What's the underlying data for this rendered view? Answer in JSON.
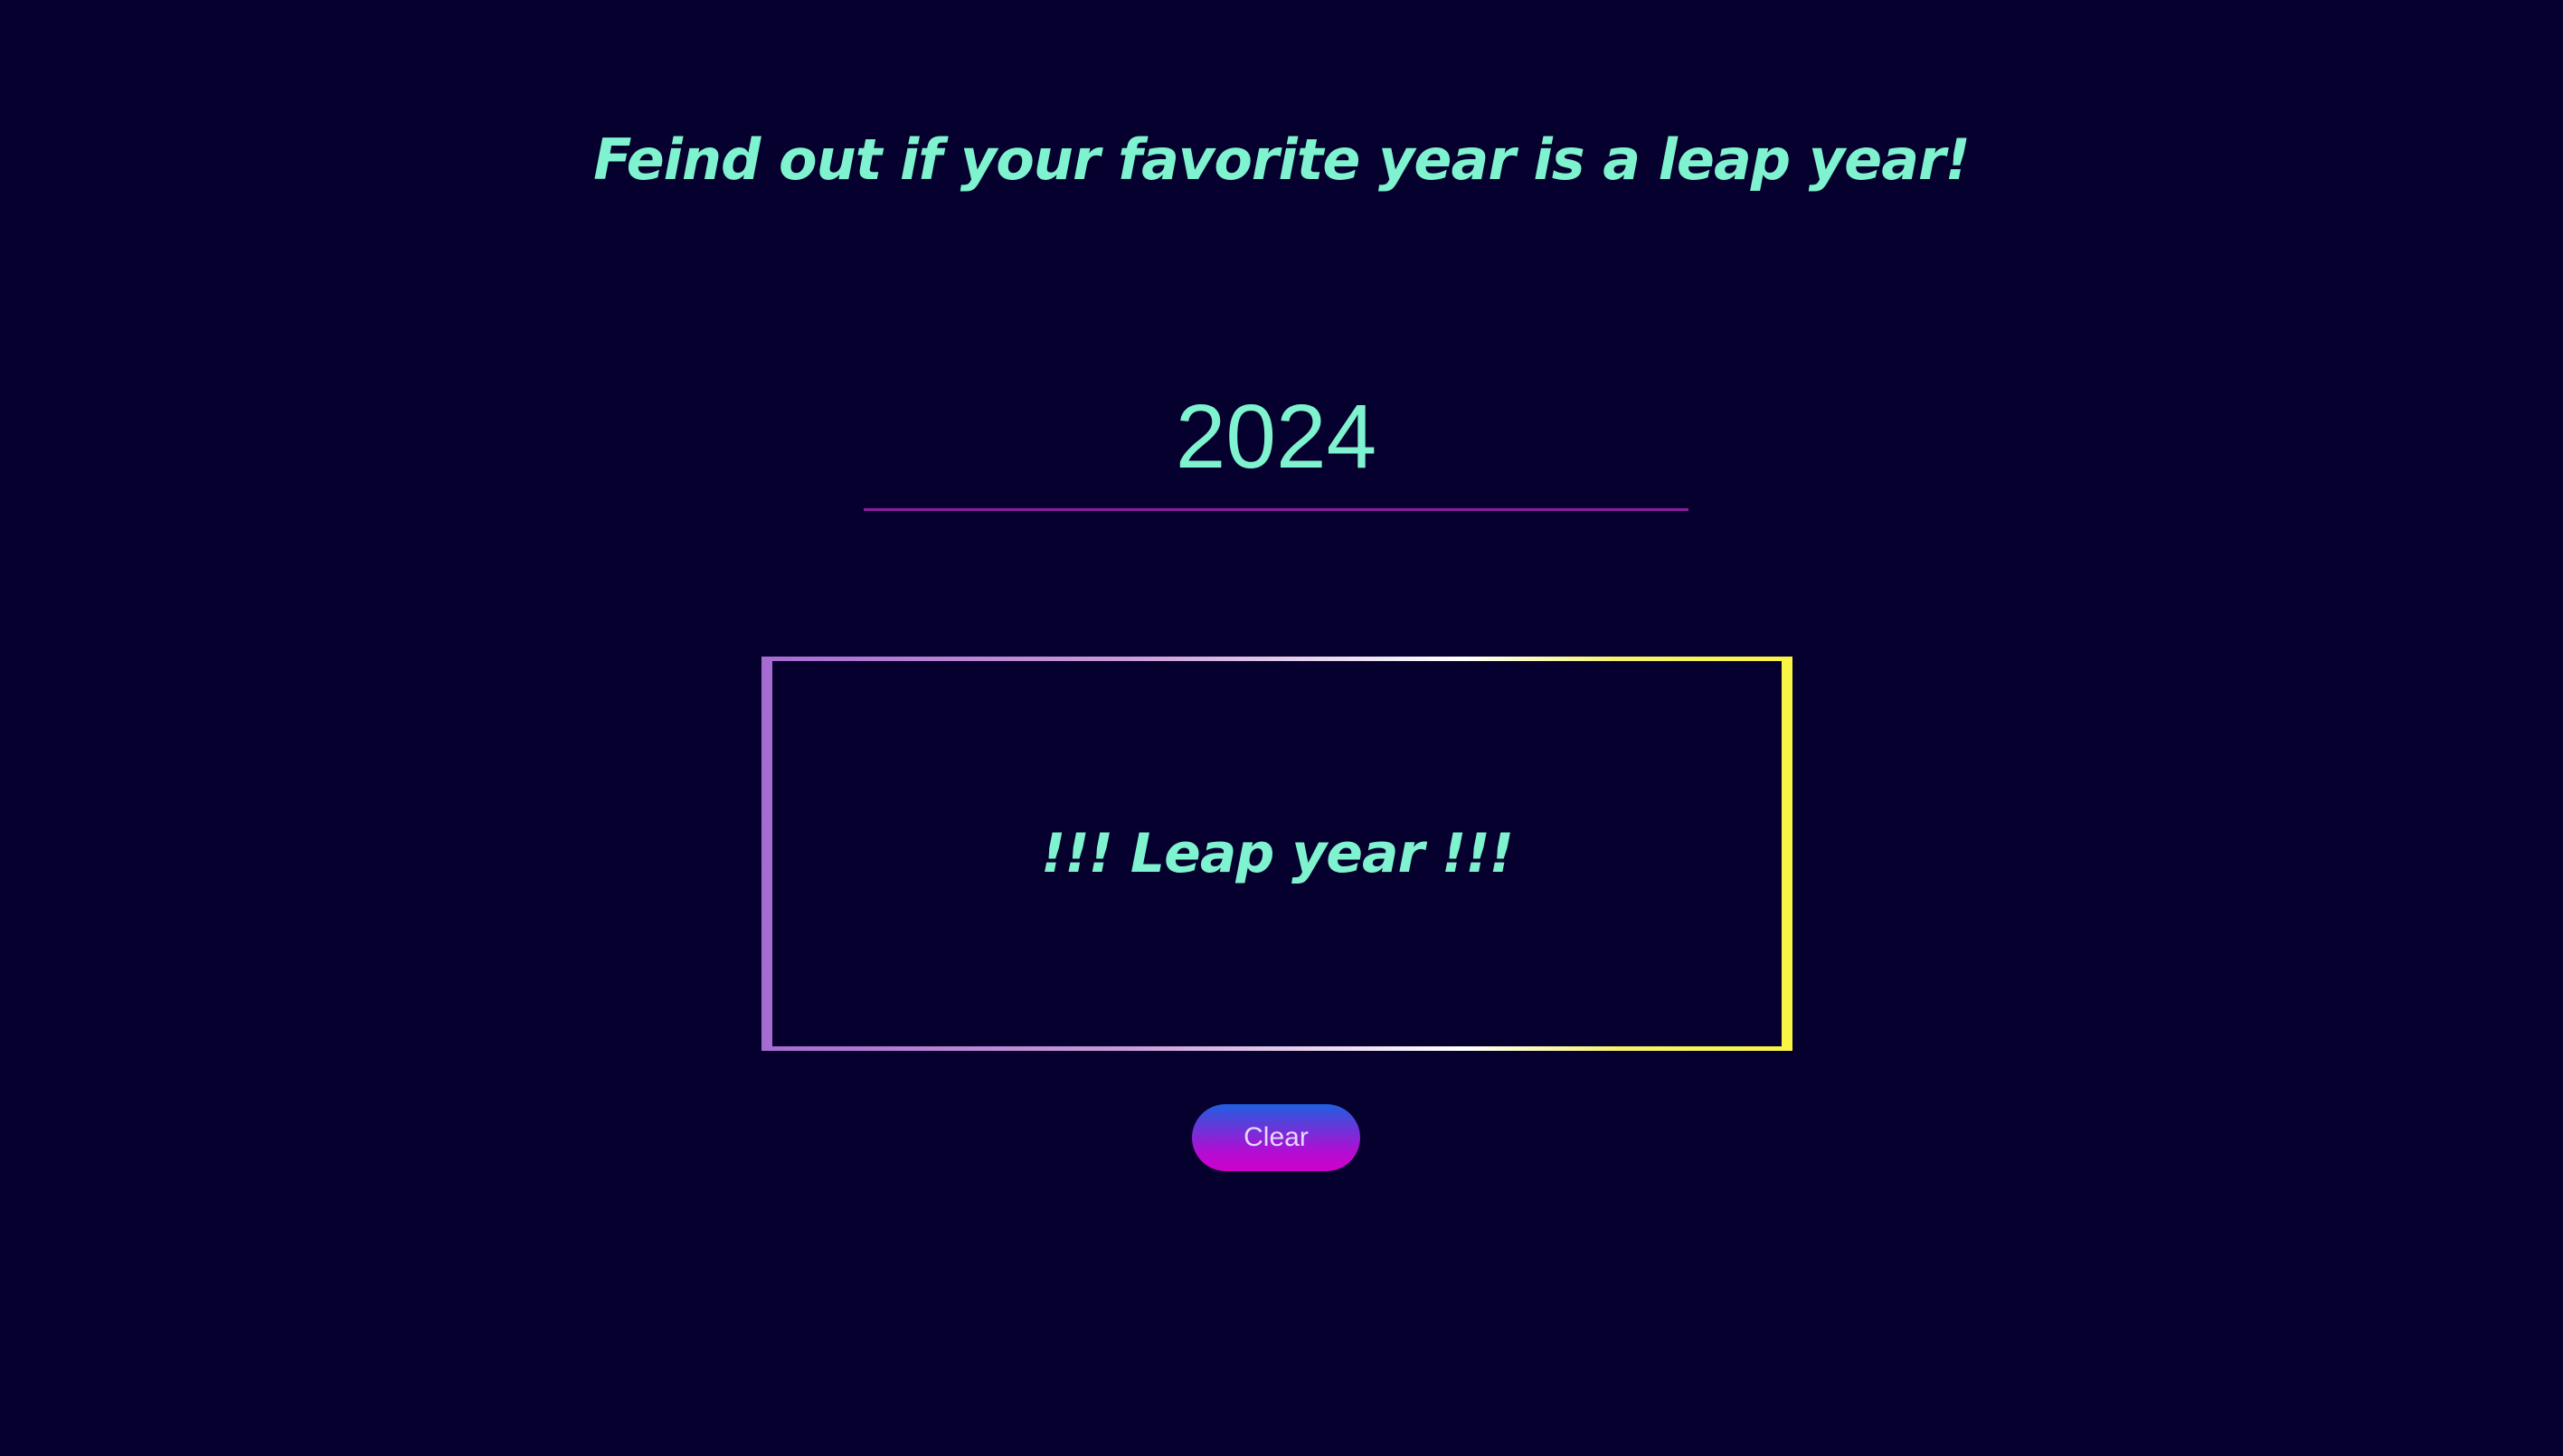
{
  "header": {
    "title": "Feind out if your favorite year is a leap year!"
  },
  "year_input": {
    "value": "2024"
  },
  "result": {
    "message": "!!! Leap year !!!"
  },
  "actions": {
    "clear_label": "Clear"
  },
  "colors": {
    "background": "#06002e",
    "text_accent": "#7ff3cf",
    "input_underline": "#8a1aa0",
    "button_gradient_top": "#1f5fe0",
    "button_gradient_bottom": "#d000cc",
    "frame_left": "#a66bd1",
    "frame_right": "#f8f543"
  }
}
